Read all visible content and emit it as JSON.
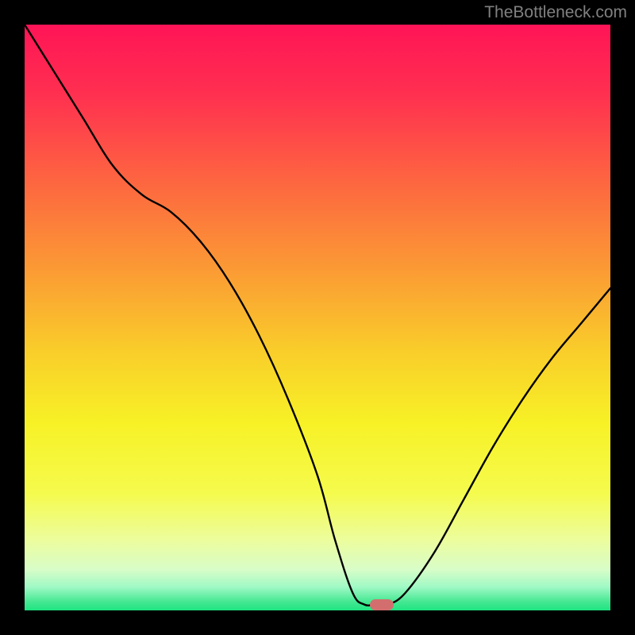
{
  "watermark": "TheBottleneck.com",
  "chart_data": {
    "type": "line",
    "title": "",
    "xlabel": "",
    "ylabel": "",
    "xlim": [
      0,
      100
    ],
    "ylim": [
      0,
      100
    ],
    "x": [
      0,
      5,
      10,
      15,
      20,
      25,
      30,
      35,
      40,
      45,
      50,
      53,
      56,
      58,
      60,
      62,
      65,
      70,
      75,
      80,
      85,
      90,
      95,
      100
    ],
    "values": [
      100,
      92,
      84,
      76,
      71,
      68,
      63,
      56,
      47,
      36,
      23,
      12,
      3,
      1,
      1,
      1,
      3,
      10,
      19,
      28,
      36,
      43,
      49,
      55
    ],
    "marker": {
      "x": 61,
      "y": 1
    },
    "background_gradient": {
      "stops": [
        {
          "offset": 0.0,
          "color": "#ff1456"
        },
        {
          "offset": 0.12,
          "color": "#ff3050"
        },
        {
          "offset": 0.28,
          "color": "#fd6a3f"
        },
        {
          "offset": 0.42,
          "color": "#fb9b34"
        },
        {
          "offset": 0.56,
          "color": "#f9ce2a"
        },
        {
          "offset": 0.68,
          "color": "#f7f126"
        },
        {
          "offset": 0.8,
          "color": "#f5fb4d"
        },
        {
          "offset": 0.88,
          "color": "#ecfd9d"
        },
        {
          "offset": 0.93,
          "color": "#d8fdc8"
        },
        {
          "offset": 0.96,
          "color": "#a0f9c5"
        },
        {
          "offset": 0.985,
          "color": "#46e893"
        },
        {
          "offset": 1.0,
          "color": "#1de480"
        }
      ]
    },
    "curve_color": "#000000",
    "marker_color": "#d26f6e"
  }
}
